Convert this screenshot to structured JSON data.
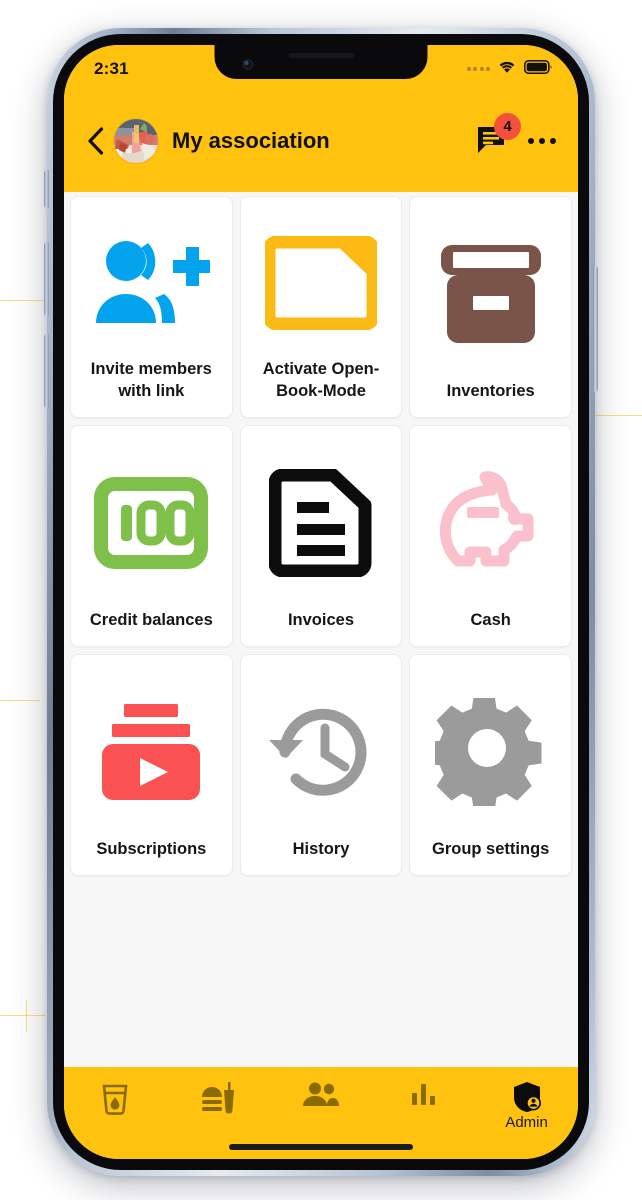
{
  "status_bar": {
    "time": "2:31",
    "icons": [
      "cellular-signal-icon",
      "wifi-icon",
      "battery-icon"
    ]
  },
  "app_bar": {
    "back_icon": "chevron-left-icon",
    "avatar": "group-avatar",
    "title": "My association",
    "chat_icon": "chat-icon",
    "unread_count": "4",
    "overflow_icon": "overflow-menu-icon",
    "background_color": "#FFC20E"
  },
  "grid": {
    "tiles": [
      {
        "label": "Invite members with link",
        "icon": "person-add-icon",
        "icon_color": "#04A3EE"
      },
      {
        "label": "Activate Open-Book-Mode",
        "icon": "folder-icon",
        "icon_color": "#FBBA14"
      },
      {
        "label": "Inventories",
        "icon": "archive-box-icon",
        "icon_color": "#7A5449"
      },
      {
        "label": "Credit balances",
        "icon": "hundred-banknote-icon",
        "icon_color": "#7FC04A"
      },
      {
        "label": "Invoices",
        "icon": "document-icon",
        "icon_color": "#0C0C0C"
      },
      {
        "label": "Cash",
        "icon": "piggy-bank-icon",
        "icon_color": "#FAC0CB"
      },
      {
        "label": "Subscriptions",
        "icon": "subscriptions-play-icon",
        "icon_color": "#FA5252"
      },
      {
        "label": "History",
        "icon": "history-clock-icon",
        "icon_color": "#9B9B9B"
      },
      {
        "label": "Group settings",
        "icon": "gear-icon",
        "icon_color": "#9B9B9B"
      }
    ]
  },
  "bottom_nav": {
    "background_color": "#FFC20E",
    "items": [
      {
        "label": "",
        "icon": "drink-cup-icon",
        "active": false
      },
      {
        "label": "",
        "icon": "fast-food-icon",
        "active": false
      },
      {
        "label": "",
        "icon": "people-icon",
        "active": false
      },
      {
        "label": "",
        "icon": "bar-chart-icon",
        "active": false
      },
      {
        "label": "Admin",
        "icon": "admin-shield-icon",
        "active": true
      }
    ]
  },
  "theme": {
    "accent": "#FFC20E",
    "badge": "#F4513C",
    "tile_background": "#FFFFFF",
    "page_background": "#F7F7F7",
    "text": "#161616"
  }
}
